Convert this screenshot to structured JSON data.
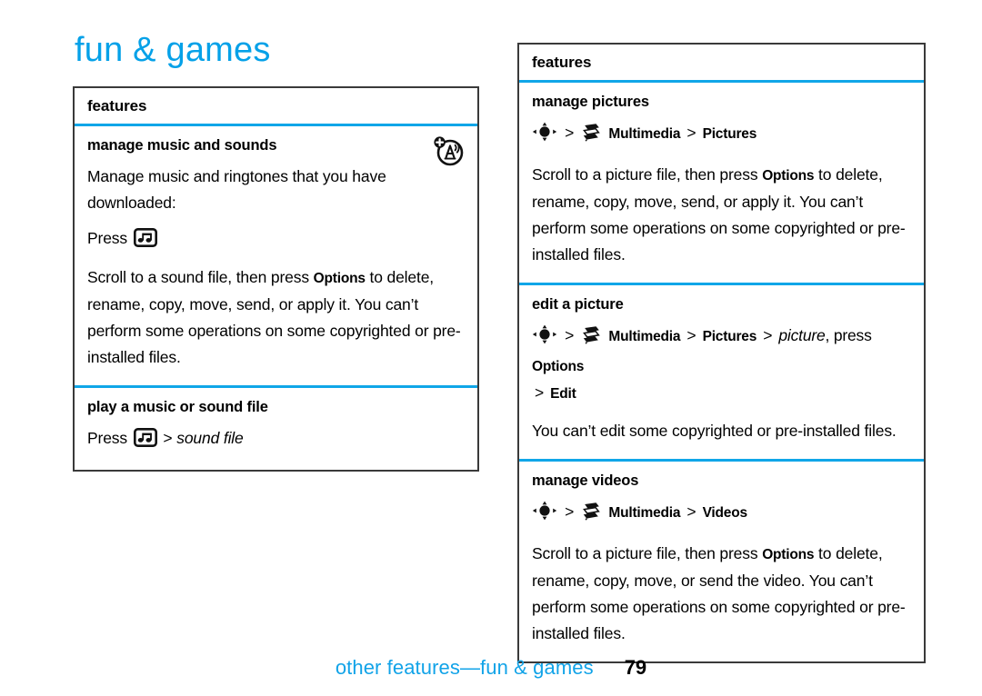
{
  "page": {
    "title": "fun & games",
    "title_color": "#05A1E8",
    "accent_color": "#10A6E8",
    "footer_text": "other features—fun & games",
    "footer_page_number": "79"
  },
  "left_column": {
    "header": "features",
    "sections": [
      {
        "title": "manage music and sounds",
        "corner_icon": "add-sound-tower-icon",
        "paragraph_1": "Manage music and ringtones that you have downloaded:",
        "press_label": "Press",
        "press_icon": "music-note-key-icon",
        "paragraph_2_a": "Scroll to a sound file, then press ",
        "paragraph_2_bold": "Options",
        "paragraph_2_b": " to delete, rename, copy, move, send, or apply it. You can’t perform some operations on some copyrighted or pre-installed files."
      },
      {
        "title": "play a music or sound file",
        "press_label": "Press",
        "press_icon": "music-note-key-icon",
        "separator": ">",
        "target_italic": "sound file"
      }
    ]
  },
  "right_column": {
    "header": "features",
    "sections": [
      {
        "title": "manage pictures",
        "path": {
          "nav_icon": "nav-dpad-key-icon",
          "sep_1": ">",
          "menu_icon": "multimedia-icon",
          "item_1": "Multimedia",
          "sep_2": ">",
          "item_2": "Pictures"
        },
        "body_a": "Scroll to a picture file, then press ",
        "body_bold": "Options",
        "body_b": " to delete, rename, copy, move, send, or apply it. You can’t perform some operations on some copyrighted or pre-installed files."
      },
      {
        "title": "edit a picture",
        "path": {
          "nav_icon": "nav-dpad-key-icon",
          "sep_1": ">",
          "menu_icon": "multimedia-icon",
          "item_1": "Multimedia",
          "sep_2": ">",
          "item_2": "Pictures",
          "sep_3": ">",
          "item_italic": "picture",
          "comma_press": ", press ",
          "item_3": "Options",
          "sep_4": ">",
          "item_4": "Edit"
        },
        "body": "You can’t edit some copyrighted or pre-installed files."
      },
      {
        "title": "manage videos",
        "path": {
          "nav_icon": "nav-dpad-key-icon",
          "sep_1": ">",
          "menu_icon": "multimedia-icon",
          "item_1": "Multimedia",
          "sep_2": ">",
          "item_2": "Videos"
        },
        "body_a": "Scroll to a picture file, then press ",
        "body_bold": "Options",
        "body_b": " to delete, rename, copy, move, or send the video. You can’t perform some operations on some copyrighted or pre-installed files."
      }
    ]
  }
}
